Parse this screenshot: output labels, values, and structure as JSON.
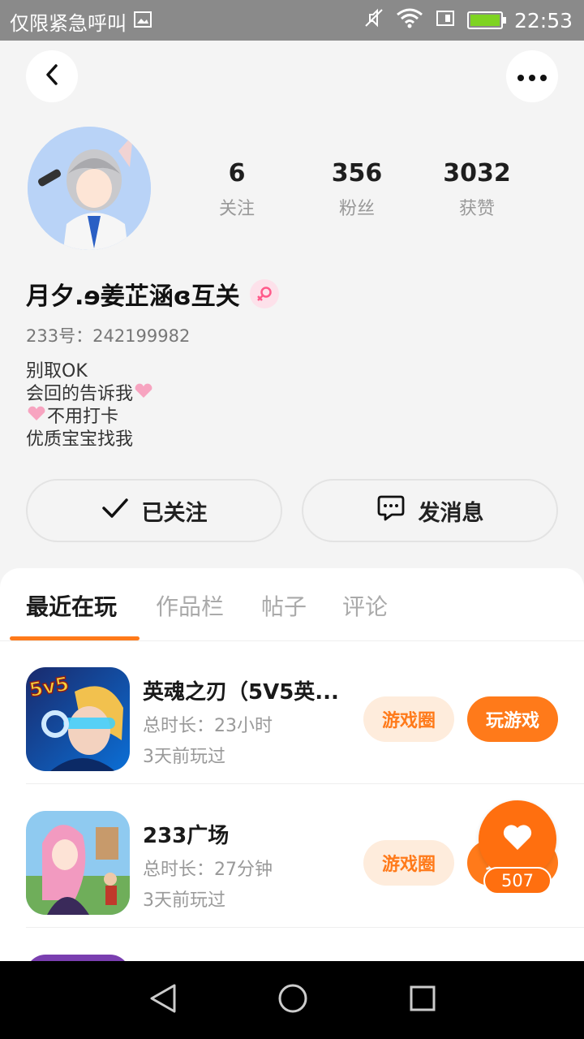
{
  "status_bar": {
    "carrier_text": "仅限紧急呼叫",
    "time": "22:53",
    "icons": [
      "image-icon",
      "mute-icon",
      "wifi-icon",
      "sim-icon",
      "battery-icon"
    ]
  },
  "header": {
    "back_icon": "chevron-left-icon",
    "more_icon": "ellipsis-icon"
  },
  "profile": {
    "stats": [
      {
        "value": "6",
        "label": "关注"
      },
      {
        "value": "356",
        "label": "粉丝"
      },
      {
        "value": "3032",
        "label": "获赞"
      }
    ],
    "nickname": "月夕.ɘ姜芷涵ɞ互关",
    "gender_icon": "female-icon",
    "uid_prefix": "233号：",
    "uid_value": "242199982",
    "bio": [
      "别取OK",
      "会回的告诉我",
      "不用打卡",
      "优质宝宝找我"
    ],
    "follow_label": "已关注",
    "message_label": "发消息"
  },
  "tabs": [
    {
      "label": "最近在玩",
      "active": true
    },
    {
      "label": "作品栏",
      "active": false
    },
    {
      "label": "帖子",
      "active": false
    },
    {
      "label": "评论",
      "active": false
    }
  ],
  "games": [
    {
      "name": "英魂之刃（5V5英...",
      "duration_label": "总时长：",
      "duration_value": "23小时",
      "last_played": "3天前玩过",
      "community_label": "游戏圈",
      "play_label": "玩游戏",
      "icon_text": "5v5"
    },
    {
      "name": "233广场",
      "duration_label": "总时长：",
      "duration_value": "27分钟",
      "last_played": "3天前玩过",
      "community_label": "游戏圈",
      "play_label": "玩游戏"
    }
  ],
  "like_fab": {
    "count": "507",
    "icon": "heart-icon"
  },
  "colors": {
    "accent": "#ff7a1a",
    "accent_light": "#feecdc",
    "status_bar": "#8a8a8a",
    "battery": "#7ed321"
  }
}
